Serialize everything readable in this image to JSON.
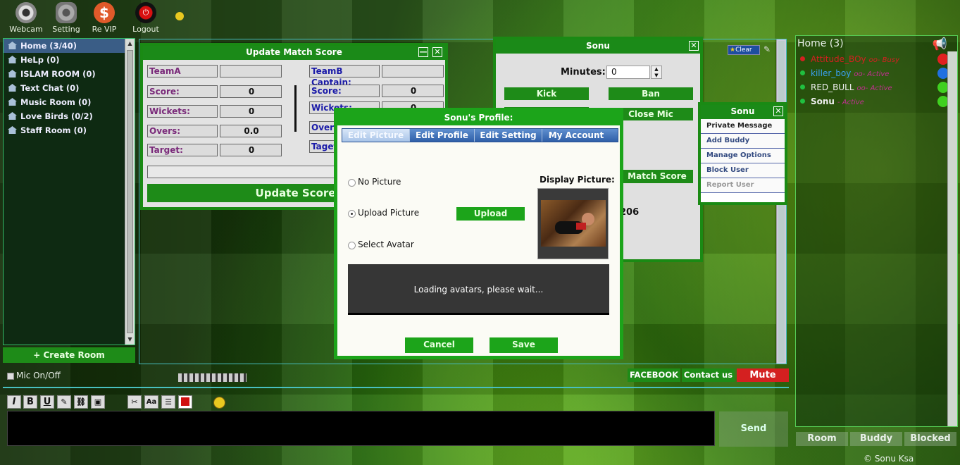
{
  "toolbar": {
    "webcam": "Webcam",
    "setting": "Setting",
    "revip": "Re VIP",
    "logout": "Logout"
  },
  "rooms": [
    {
      "name": "Home (3/40)"
    },
    {
      "name": "HeLp (0)"
    },
    {
      "name": "ISLAM ROOM (0)"
    },
    {
      "name": "Text Chat (0)"
    },
    {
      "name": "Music Room (0)"
    },
    {
      "name": "Love Birds (0/2)"
    },
    {
      "name": "Staff Room (0)"
    }
  ],
  "create_room": "+ Create Room",
  "mic_toggle": "Mic On/Off",
  "score_window": {
    "title": "Update Match Score",
    "teamA_label": "TeamA",
    "teamB_label": "TeamB Captain:",
    "score_label": "Score:",
    "wickets_label": "Wickets:",
    "overs_label": "Overs:",
    "target_label": "Target:",
    "target_label_right": "Taget",
    "score_a": "0",
    "wickets_a": "0",
    "overs_a": "0.0",
    "target_a": "0",
    "score_b": "0",
    "wickets_b": "0",
    "update_btn": "Update Score"
  },
  "user_window": {
    "title": "Sonu",
    "minutes_label": "Minutes:",
    "minutes_value": "0",
    "kick": "Kick",
    "ban": "Ban",
    "close_mic": "Close Mic",
    "match_score": "Match Score",
    "partial_number": "206"
  },
  "profile": {
    "title": "Sonu's Profile:",
    "tabs": [
      "Edit Picture",
      "Edit Profile",
      "Edit Setting",
      "My Account"
    ],
    "no_picture": "No Picture",
    "upload_picture": "Upload Picture",
    "select_avatar": "Select Avatar",
    "upload_btn": "Upload",
    "display_picture": "Display Picture:",
    "loading": "Loading avatars, please wait...",
    "cancel": "Cancel",
    "save": "Save"
  },
  "action_menu": {
    "title": "Sonu",
    "items": [
      "Private Message",
      "Add Buddy",
      "Manage Options",
      "Block User",
      "Report User"
    ]
  },
  "clear": "Clear",
  "userlist": {
    "title": "Home (3)",
    "users": [
      {
        "name": "Attitude_BOy",
        "status": "oo- Busy",
        "name_color": "#d42020",
        "dot": "#d42020",
        "smiley": "#e02020"
      },
      {
        "name": "killer_boy",
        "status": "oo- Active",
        "name_color": "#3aa0f0",
        "dot": "#20c040",
        "smiley": "#2070e0"
      },
      {
        "name": "RED_BULL",
        "status": "oo- Active",
        "name_color": "#f0f0f0",
        "dot": "#20c040",
        "smiley": "#40d020"
      },
      {
        "name": "Sonu",
        "status": "- Active",
        "name_color": "#f0f0f0",
        "dot": "#20c040",
        "smiley": "#40d020"
      }
    ],
    "tabs": [
      "Room",
      "Buddy",
      "Blocked"
    ]
  },
  "bottom": {
    "facebook": "FACEBOOK",
    "contact": "Contact us",
    "mute": "Mute",
    "send": "Send",
    "copyright": "© Sonu Ksa"
  },
  "colors": {
    "accent_green": "#1e8b18",
    "mute_red": "#d42020"
  }
}
